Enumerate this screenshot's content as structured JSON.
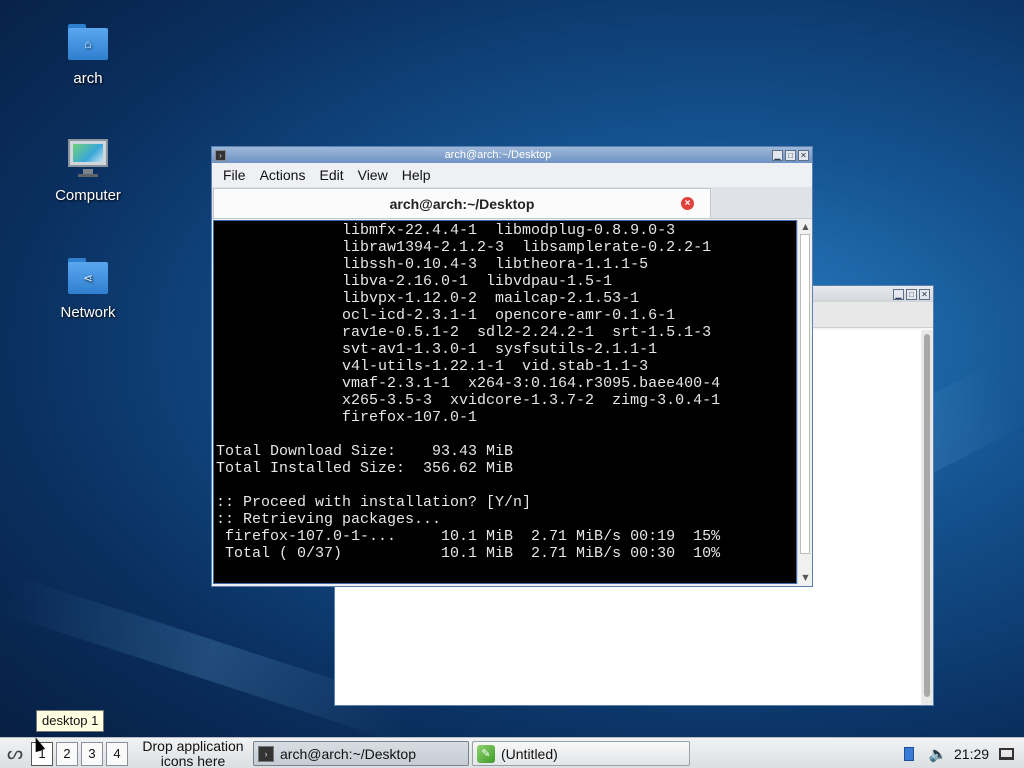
{
  "desktop": {
    "icons": [
      {
        "label": "arch",
        "icon": "home-folder-icon"
      },
      {
        "label": "Computer",
        "icon": "computer-icon"
      },
      {
        "label": "Network",
        "icon": "network-folder-icon"
      }
    ]
  },
  "editor_window": {
    "buttons": {
      "minimize": "▁",
      "maximize": "□",
      "close": "✕"
    }
  },
  "terminal_window": {
    "title": "arch@arch:~/Desktop",
    "window_icon": "terminal-icon",
    "buttons": {
      "minimize": "▁",
      "maximize": "□",
      "close": "✕"
    },
    "menu": [
      "File",
      "Actions",
      "Edit",
      "View",
      "Help"
    ],
    "tab": {
      "label": "arch@arch:~/Desktop",
      "close": "×"
    },
    "lines": [
      "              libmfx-22.4.4-1  libmodplug-0.8.9.0-3",
      "              libraw1394-2.1.2-3  libsamplerate-0.2.2-1",
      "              libssh-0.10.4-3  libtheora-1.1.1-5",
      "              libva-2.16.0-1  libvdpau-1.5-1",
      "              libvpx-1.12.0-2  mailcap-2.1.53-1",
      "              ocl-icd-2.3.1-1  opencore-amr-0.1.6-1",
      "              rav1e-0.5.1-2  sdl2-2.24.2-1  srt-1.5.1-3",
      "              svt-av1-1.3.0-1  sysfsutils-2.1.1-1",
      "              v4l-utils-1.22.1-1  vid.stab-1.1-3",
      "              vmaf-2.3.1-1  x264-3:0.164.r3095.baee400-4",
      "              x265-3.5-3  xvidcore-1.3.7-2  zimg-3.0.4-1",
      "              firefox-107.0-1",
      "",
      "Total Download Size:    93.43 MiB",
      "Total Installed Size:  356.62 MiB",
      "",
      ":: Proceed with installation? [Y/n]",
      ":: Retrieving packages...",
      " firefox-107.0-1-...     10.1 MiB  2.71 MiB/s 00:19  15%",
      " Total ( 0/37)           10.1 MiB  2.71 MiB/s 00:30  10%"
    ]
  },
  "tooltip": "desktop 1",
  "taskbar": {
    "start_icon": "lxqt-menu-icon",
    "desktops": [
      "1",
      "2",
      "3",
      "4"
    ],
    "drop_text_line1": "Drop application",
    "drop_text_line2": "icons here",
    "tasks": [
      {
        "label": "arch@arch:~/Desktop",
        "icon": "terminal-icon",
        "active": true
      },
      {
        "label": "(Untitled)",
        "icon": "text-editor-icon",
        "active": false
      }
    ],
    "clock": "21:29"
  }
}
